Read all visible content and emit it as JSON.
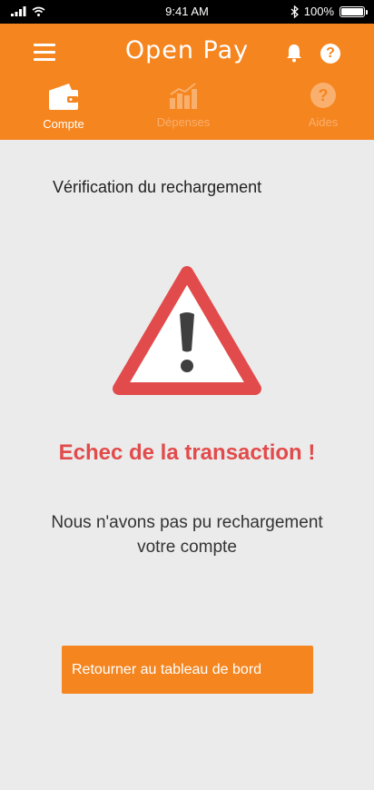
{
  "status_bar": {
    "time": "9:41 AM",
    "battery": "100%",
    "battery_level": 1.0
  },
  "header": {
    "logo": "Open Pay"
  },
  "tabs": [
    {
      "label": "Compte",
      "active": true,
      "icon": "wallet-icon"
    },
    {
      "label": "Dépenses",
      "active": false,
      "icon": "bar-chart-icon"
    },
    {
      "label": "Aides",
      "active": false,
      "icon": "help-icon"
    }
  ],
  "page": {
    "title": "Vérification du rechargement"
  },
  "result": {
    "heading": "Echec de la transaction !",
    "message": "Nous n'avons pas pu rechargement votre compte",
    "icon": "warning-icon"
  },
  "actions": {
    "back_button": "Retourner au tableau de bord"
  },
  "colors": {
    "brand": "#f5851f",
    "error": "#e24b4b",
    "background": "#ebebeb"
  }
}
